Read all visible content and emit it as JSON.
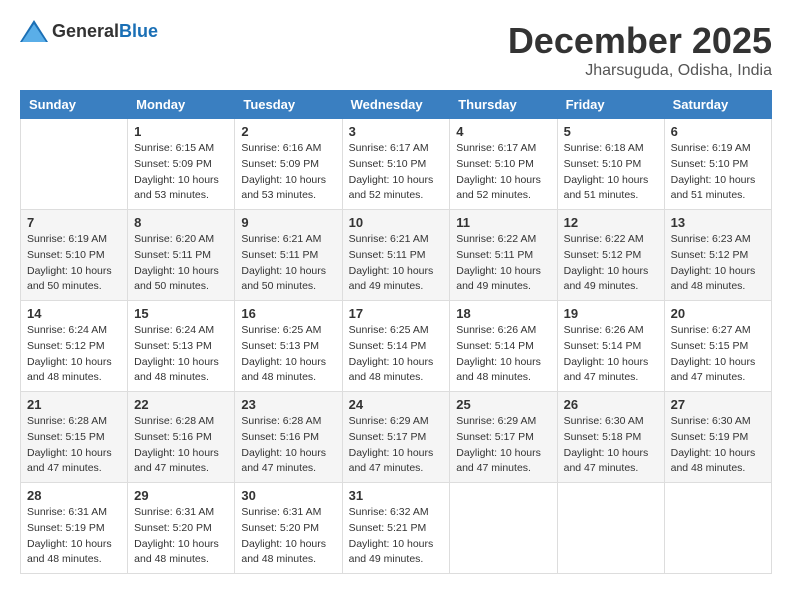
{
  "logo": {
    "general": "General",
    "blue": "Blue"
  },
  "title": {
    "month_year": "December 2025",
    "location": "Jharsuguda, Odisha, India"
  },
  "headers": [
    "Sunday",
    "Monday",
    "Tuesday",
    "Wednesday",
    "Thursday",
    "Friday",
    "Saturday"
  ],
  "weeks": [
    [
      {
        "day": "",
        "info": ""
      },
      {
        "day": "1",
        "info": "Sunrise: 6:15 AM\nSunset: 5:09 PM\nDaylight: 10 hours\nand 53 minutes."
      },
      {
        "day": "2",
        "info": "Sunrise: 6:16 AM\nSunset: 5:09 PM\nDaylight: 10 hours\nand 53 minutes."
      },
      {
        "day": "3",
        "info": "Sunrise: 6:17 AM\nSunset: 5:10 PM\nDaylight: 10 hours\nand 52 minutes."
      },
      {
        "day": "4",
        "info": "Sunrise: 6:17 AM\nSunset: 5:10 PM\nDaylight: 10 hours\nand 52 minutes."
      },
      {
        "day": "5",
        "info": "Sunrise: 6:18 AM\nSunset: 5:10 PM\nDaylight: 10 hours\nand 51 minutes."
      },
      {
        "day": "6",
        "info": "Sunrise: 6:19 AM\nSunset: 5:10 PM\nDaylight: 10 hours\nand 51 minutes."
      }
    ],
    [
      {
        "day": "7",
        "info": "Sunrise: 6:19 AM\nSunset: 5:10 PM\nDaylight: 10 hours\nand 50 minutes."
      },
      {
        "day": "8",
        "info": "Sunrise: 6:20 AM\nSunset: 5:11 PM\nDaylight: 10 hours\nand 50 minutes."
      },
      {
        "day": "9",
        "info": "Sunrise: 6:21 AM\nSunset: 5:11 PM\nDaylight: 10 hours\nand 50 minutes."
      },
      {
        "day": "10",
        "info": "Sunrise: 6:21 AM\nSunset: 5:11 PM\nDaylight: 10 hours\nand 49 minutes."
      },
      {
        "day": "11",
        "info": "Sunrise: 6:22 AM\nSunset: 5:11 PM\nDaylight: 10 hours\nand 49 minutes."
      },
      {
        "day": "12",
        "info": "Sunrise: 6:22 AM\nSunset: 5:12 PM\nDaylight: 10 hours\nand 49 minutes."
      },
      {
        "day": "13",
        "info": "Sunrise: 6:23 AM\nSunset: 5:12 PM\nDaylight: 10 hours\nand 48 minutes."
      }
    ],
    [
      {
        "day": "14",
        "info": "Sunrise: 6:24 AM\nSunset: 5:12 PM\nDaylight: 10 hours\nand 48 minutes."
      },
      {
        "day": "15",
        "info": "Sunrise: 6:24 AM\nSunset: 5:13 PM\nDaylight: 10 hours\nand 48 minutes."
      },
      {
        "day": "16",
        "info": "Sunrise: 6:25 AM\nSunset: 5:13 PM\nDaylight: 10 hours\nand 48 minutes."
      },
      {
        "day": "17",
        "info": "Sunrise: 6:25 AM\nSunset: 5:14 PM\nDaylight: 10 hours\nand 48 minutes."
      },
      {
        "day": "18",
        "info": "Sunrise: 6:26 AM\nSunset: 5:14 PM\nDaylight: 10 hours\nand 48 minutes."
      },
      {
        "day": "19",
        "info": "Sunrise: 6:26 AM\nSunset: 5:14 PM\nDaylight: 10 hours\nand 47 minutes."
      },
      {
        "day": "20",
        "info": "Sunrise: 6:27 AM\nSunset: 5:15 PM\nDaylight: 10 hours\nand 47 minutes."
      }
    ],
    [
      {
        "day": "21",
        "info": "Sunrise: 6:28 AM\nSunset: 5:15 PM\nDaylight: 10 hours\nand 47 minutes."
      },
      {
        "day": "22",
        "info": "Sunrise: 6:28 AM\nSunset: 5:16 PM\nDaylight: 10 hours\nand 47 minutes."
      },
      {
        "day": "23",
        "info": "Sunrise: 6:28 AM\nSunset: 5:16 PM\nDaylight: 10 hours\nand 47 minutes."
      },
      {
        "day": "24",
        "info": "Sunrise: 6:29 AM\nSunset: 5:17 PM\nDaylight: 10 hours\nand 47 minutes."
      },
      {
        "day": "25",
        "info": "Sunrise: 6:29 AM\nSunset: 5:17 PM\nDaylight: 10 hours\nand 47 minutes."
      },
      {
        "day": "26",
        "info": "Sunrise: 6:30 AM\nSunset: 5:18 PM\nDaylight: 10 hours\nand 47 minutes."
      },
      {
        "day": "27",
        "info": "Sunrise: 6:30 AM\nSunset: 5:19 PM\nDaylight: 10 hours\nand 48 minutes."
      }
    ],
    [
      {
        "day": "28",
        "info": "Sunrise: 6:31 AM\nSunset: 5:19 PM\nDaylight: 10 hours\nand 48 minutes."
      },
      {
        "day": "29",
        "info": "Sunrise: 6:31 AM\nSunset: 5:20 PM\nDaylight: 10 hours\nand 48 minutes."
      },
      {
        "day": "30",
        "info": "Sunrise: 6:31 AM\nSunset: 5:20 PM\nDaylight: 10 hours\nand 48 minutes."
      },
      {
        "day": "31",
        "info": "Sunrise: 6:32 AM\nSunset: 5:21 PM\nDaylight: 10 hours\nand 49 minutes."
      },
      {
        "day": "",
        "info": ""
      },
      {
        "day": "",
        "info": ""
      },
      {
        "day": "",
        "info": ""
      }
    ]
  ]
}
